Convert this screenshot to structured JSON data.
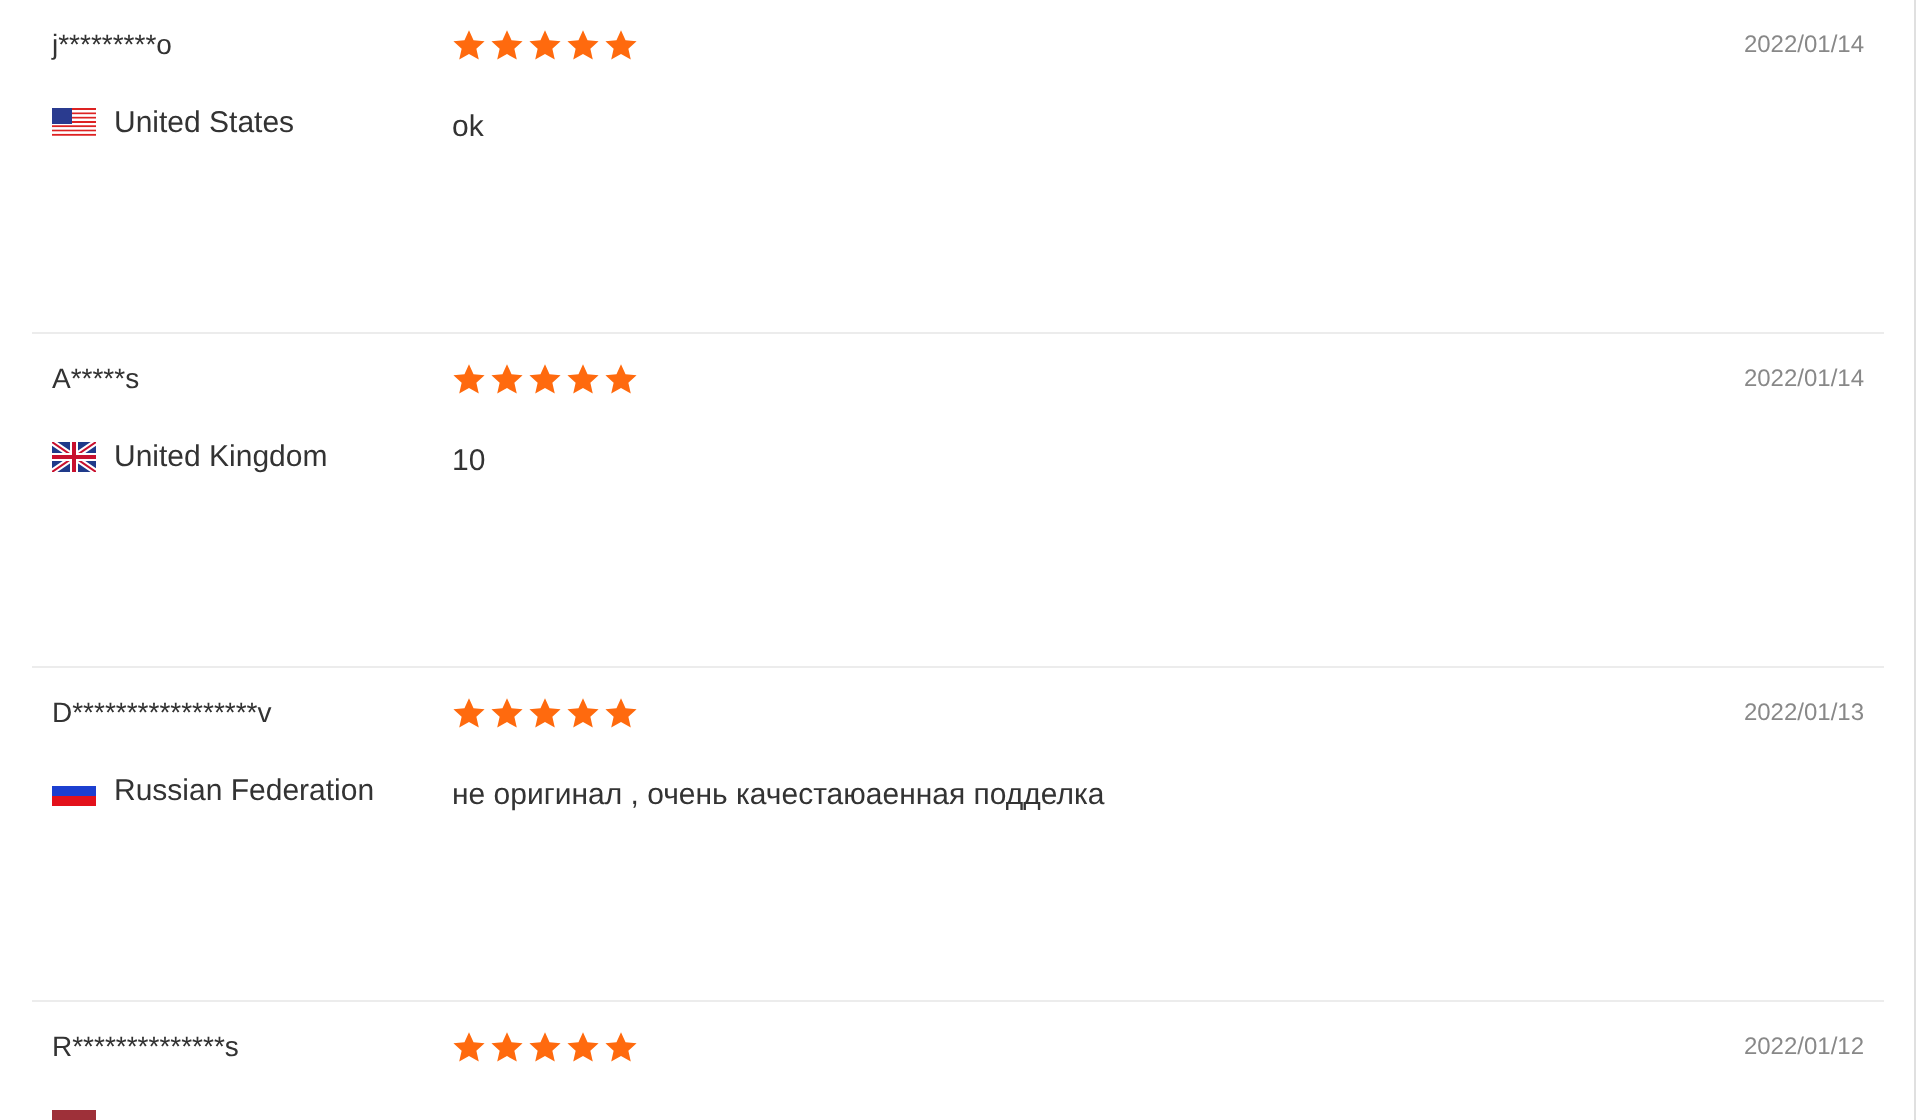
{
  "reviews": [
    {
      "name": "j*********o",
      "stars": 5,
      "date": "2022/01/14",
      "kind": "us",
      "country": "United States",
      "text": "ok"
    },
    {
      "name": "A*****s",
      "stars": 5,
      "date": "2022/01/14",
      "kind": "gb",
      "country": "United Kingdom",
      "text": "10"
    },
    {
      "name": "D*****************v",
      "stars": 5,
      "date": "2022/01/13",
      "kind": "ru",
      "country": "Russian Federation",
      "text": "не оригинал , очень качестаюаенная подделка"
    },
    {
      "name": "R**************s",
      "stars": 5,
      "date": "2022/01/12",
      "kind": "lv"
    }
  ]
}
